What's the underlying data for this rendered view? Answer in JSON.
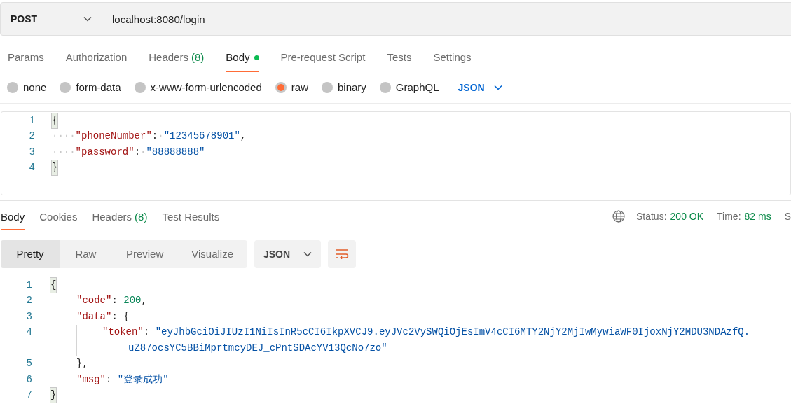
{
  "request": {
    "method": "POST",
    "url": "localhost:8080/login"
  },
  "request_tabs": [
    {
      "label": "Params",
      "selected": false
    },
    {
      "label": "Authorization",
      "selected": false
    },
    {
      "label": "Headers",
      "count": "(8)",
      "selected": false
    },
    {
      "label": "Body",
      "selected": true,
      "dot": true
    },
    {
      "label": "Pre-request Script",
      "selected": false
    },
    {
      "label": "Tests",
      "selected": false
    },
    {
      "label": "Settings",
      "selected": false
    }
  ],
  "body_types": [
    {
      "label": "none",
      "selected": false
    },
    {
      "label": "form-data",
      "selected": false
    },
    {
      "label": "x-www-form-urlencoded",
      "selected": false
    },
    {
      "label": "raw",
      "selected": true
    },
    {
      "label": "binary",
      "selected": false
    },
    {
      "label": "GraphQL",
      "selected": false
    }
  ],
  "body_format": "JSON",
  "request_body": [
    {
      "number": "1",
      "tokens": [
        {
          "kind": "brace",
          "text": "{"
        }
      ]
    },
    {
      "number": "2",
      "tokens": [
        {
          "kind": "ws",
          "text": "····"
        },
        {
          "kind": "key",
          "text": "\"phoneNumber\""
        },
        {
          "kind": "punct",
          "text": ":"
        },
        {
          "kind": "ws",
          "text": "·"
        },
        {
          "kind": "string",
          "text": "\"12345678901\""
        },
        {
          "kind": "punct",
          "text": ","
        }
      ]
    },
    {
      "number": "3",
      "tokens": [
        {
          "kind": "ws",
          "text": "····"
        },
        {
          "kind": "key",
          "text": "\"password\""
        },
        {
          "kind": "punct",
          "text": ":"
        },
        {
          "kind": "ws",
          "text": "·"
        },
        {
          "kind": "string",
          "text": "\"88888888\""
        }
      ]
    },
    {
      "number": "4",
      "tokens": [
        {
          "kind": "brace",
          "text": "}"
        }
      ]
    }
  ],
  "response_tabs": [
    {
      "label": "Body",
      "selected": true
    },
    {
      "label": "Cookies",
      "selected": false
    },
    {
      "label": "Headers",
      "count": "(8)",
      "selected": false
    },
    {
      "label": "Test Results",
      "selected": false
    }
  ],
  "response_status": [
    {
      "label": "Status:",
      "value": "200 OK"
    },
    {
      "label": "Time:",
      "value": "82 ms"
    },
    {
      "label": "S"
    }
  ],
  "view_modes": [
    {
      "label": "Pretty",
      "selected": true
    },
    {
      "label": "Raw",
      "selected": false
    },
    {
      "label": "Preview",
      "selected": false
    },
    {
      "label": "Visualize",
      "selected": false
    }
  ],
  "response_format": "JSON",
  "response_body": [
    {
      "number": "1",
      "tokens": [
        {
          "kind": "brace",
          "text": "{"
        }
      ],
      "children": [
        {
          "number": "2",
          "tokens": [
            {
              "kind": "key",
              "text": "\"code\""
            },
            {
              "kind": "punct",
              "text": ": "
            },
            {
              "kind": "number",
              "text": "200"
            },
            {
              "kind": "punct",
              "text": ","
            }
          ]
        },
        {
          "number": "3",
          "tokens": [
            {
              "kind": "key",
              "text": "\"data\""
            },
            {
              "kind": "punct",
              "text": ": {"
            }
          ],
          "children": [
            {
              "number": "4",
              "tokens": [
                {
                  "kind": "key",
                  "text": "\"token\""
                },
                {
                  "kind": "punct",
                  "text": ": "
                },
                {
                  "kind": "string",
                  "text": "\"eyJhbGciOiJIUzI1NiIsInR5cCI6IkpXVCJ9.eyJVc2VySWQiOjEsImV4cCI6MTY2NjY2MjIwMywiaWF0IjoxNjY2MDU3NDAzfQ."
                }
              ],
              "children": [
                {
                  "tokens": [
                    {
                      "kind": "string",
                      "text": "uZ87ocsYC5BBiMprtmcyDEJ_cPntSDAcYV13QcNo7zo\""
                    }
                  ]
                }
              ]
            }
          ]
        },
        {
          "number": "5",
          "tokens": [
            {
              "kind": "punct",
              "text": "},"
            }
          ]
        },
        {
          "number": "6",
          "tokens": [
            {
              "kind": "key",
              "text": "\"msg\""
            },
            {
              "kind": "punct",
              "text": ": "
            },
            {
              "kind": "string",
              "text": "\"登录成功\""
            }
          ]
        }
      ]
    },
    {
      "number": "7",
      "tokens": [
        {
          "kind": "brace",
          "text": "}"
        }
      ]
    }
  ]
}
